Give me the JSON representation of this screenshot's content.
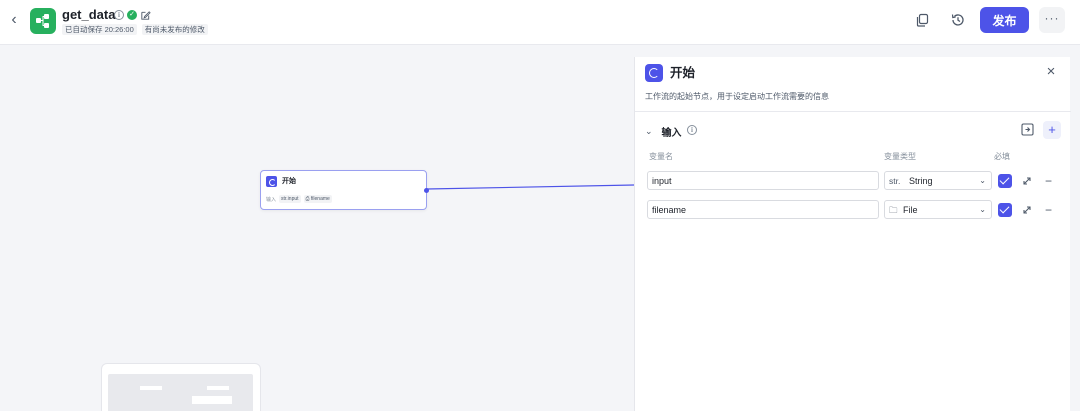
{
  "header": {
    "back_glyph": "‹",
    "app_icon": "workflow-icon",
    "title": "get_data",
    "status_tags": [
      "已自动保存 20:26:00",
      "有尚未发布的修改"
    ],
    "publish_label": "发布",
    "more_glyph": "···",
    "icons": [
      "info-icon",
      "published-check-icon",
      "edit-icon",
      "copy-icon",
      "history-icon"
    ]
  },
  "canvas": {
    "node": {
      "title": "开始",
      "inputs_label": "输入",
      "params": [
        "str.input",
        "⎙ filename"
      ]
    }
  },
  "panel": {
    "title": "开始",
    "close_glyph": "×",
    "description": "工作流的起始节点，用于设定启动工作流需要的信息",
    "section": {
      "chevron": "⌄",
      "title": "输入",
      "add_glyph": "+"
    },
    "columns": {
      "name": "变量名",
      "type": "变量类型",
      "required": "必填"
    },
    "rows": [
      {
        "name": "input",
        "type_icon": "str.",
        "type": "String",
        "required": true
      },
      {
        "name": "filename",
        "type_icon": "🗀",
        "type": "File",
        "required": true
      }
    ]
  },
  "colors": {
    "accent": "#4d53e8",
    "app_icon_green": "#27b05e",
    "canvas_bg": "#f4f5f8"
  }
}
